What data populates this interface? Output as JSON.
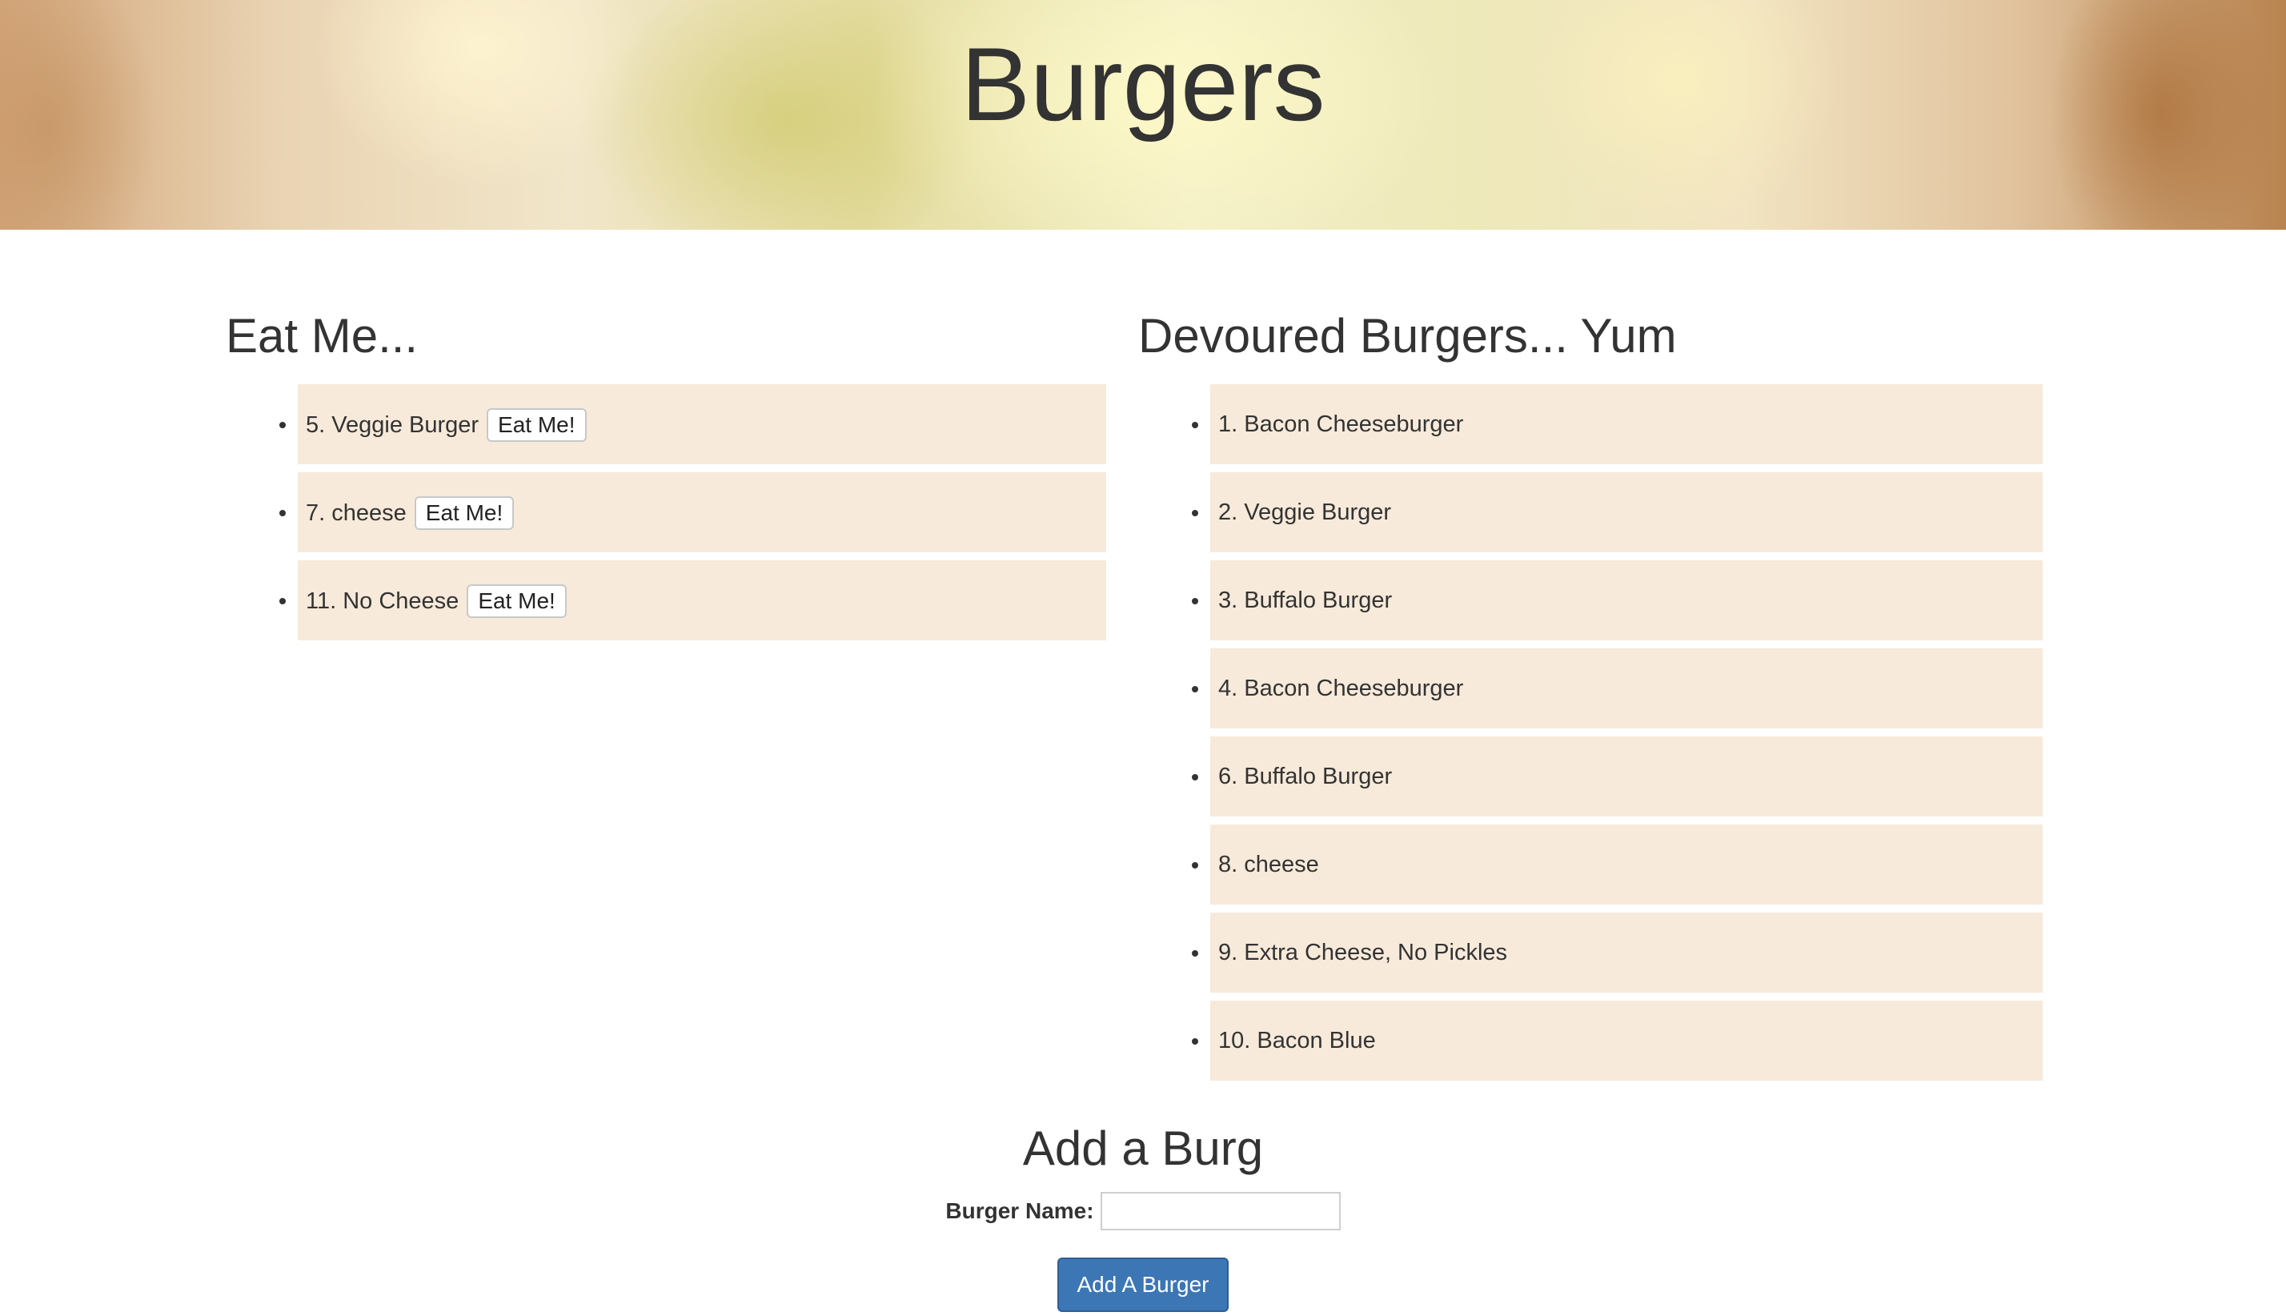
{
  "header": {
    "title": "Burgers"
  },
  "eat_column": {
    "heading": "Eat Me...",
    "items": [
      {
        "label": "5. Veggie Burger",
        "button": "Eat Me!"
      },
      {
        "label": "7. cheese",
        "button": "Eat Me!"
      },
      {
        "label": "11. No Cheese",
        "button": "Eat Me!"
      }
    ]
  },
  "devoured_column": {
    "heading": "Devoured Burgers... Yum",
    "items": [
      {
        "label": "1. Bacon Cheeseburger"
      },
      {
        "label": "2. Veggie Burger"
      },
      {
        "label": "3. Buffalo Burger"
      },
      {
        "label": "4. Bacon Cheeseburger"
      },
      {
        "label": "6. Buffalo Burger"
      },
      {
        "label": "8. cheese"
      },
      {
        "label": "9. Extra Cheese, No Pickles"
      },
      {
        "label": "10. Bacon Blue"
      }
    ]
  },
  "add_form": {
    "heading": "Add a Burg",
    "name_label": "Burger Name:",
    "name_value": "",
    "submit_label": "Add A Burger"
  },
  "colors": {
    "item_background": "#f7eada",
    "button_primary": "#3c76b5"
  }
}
